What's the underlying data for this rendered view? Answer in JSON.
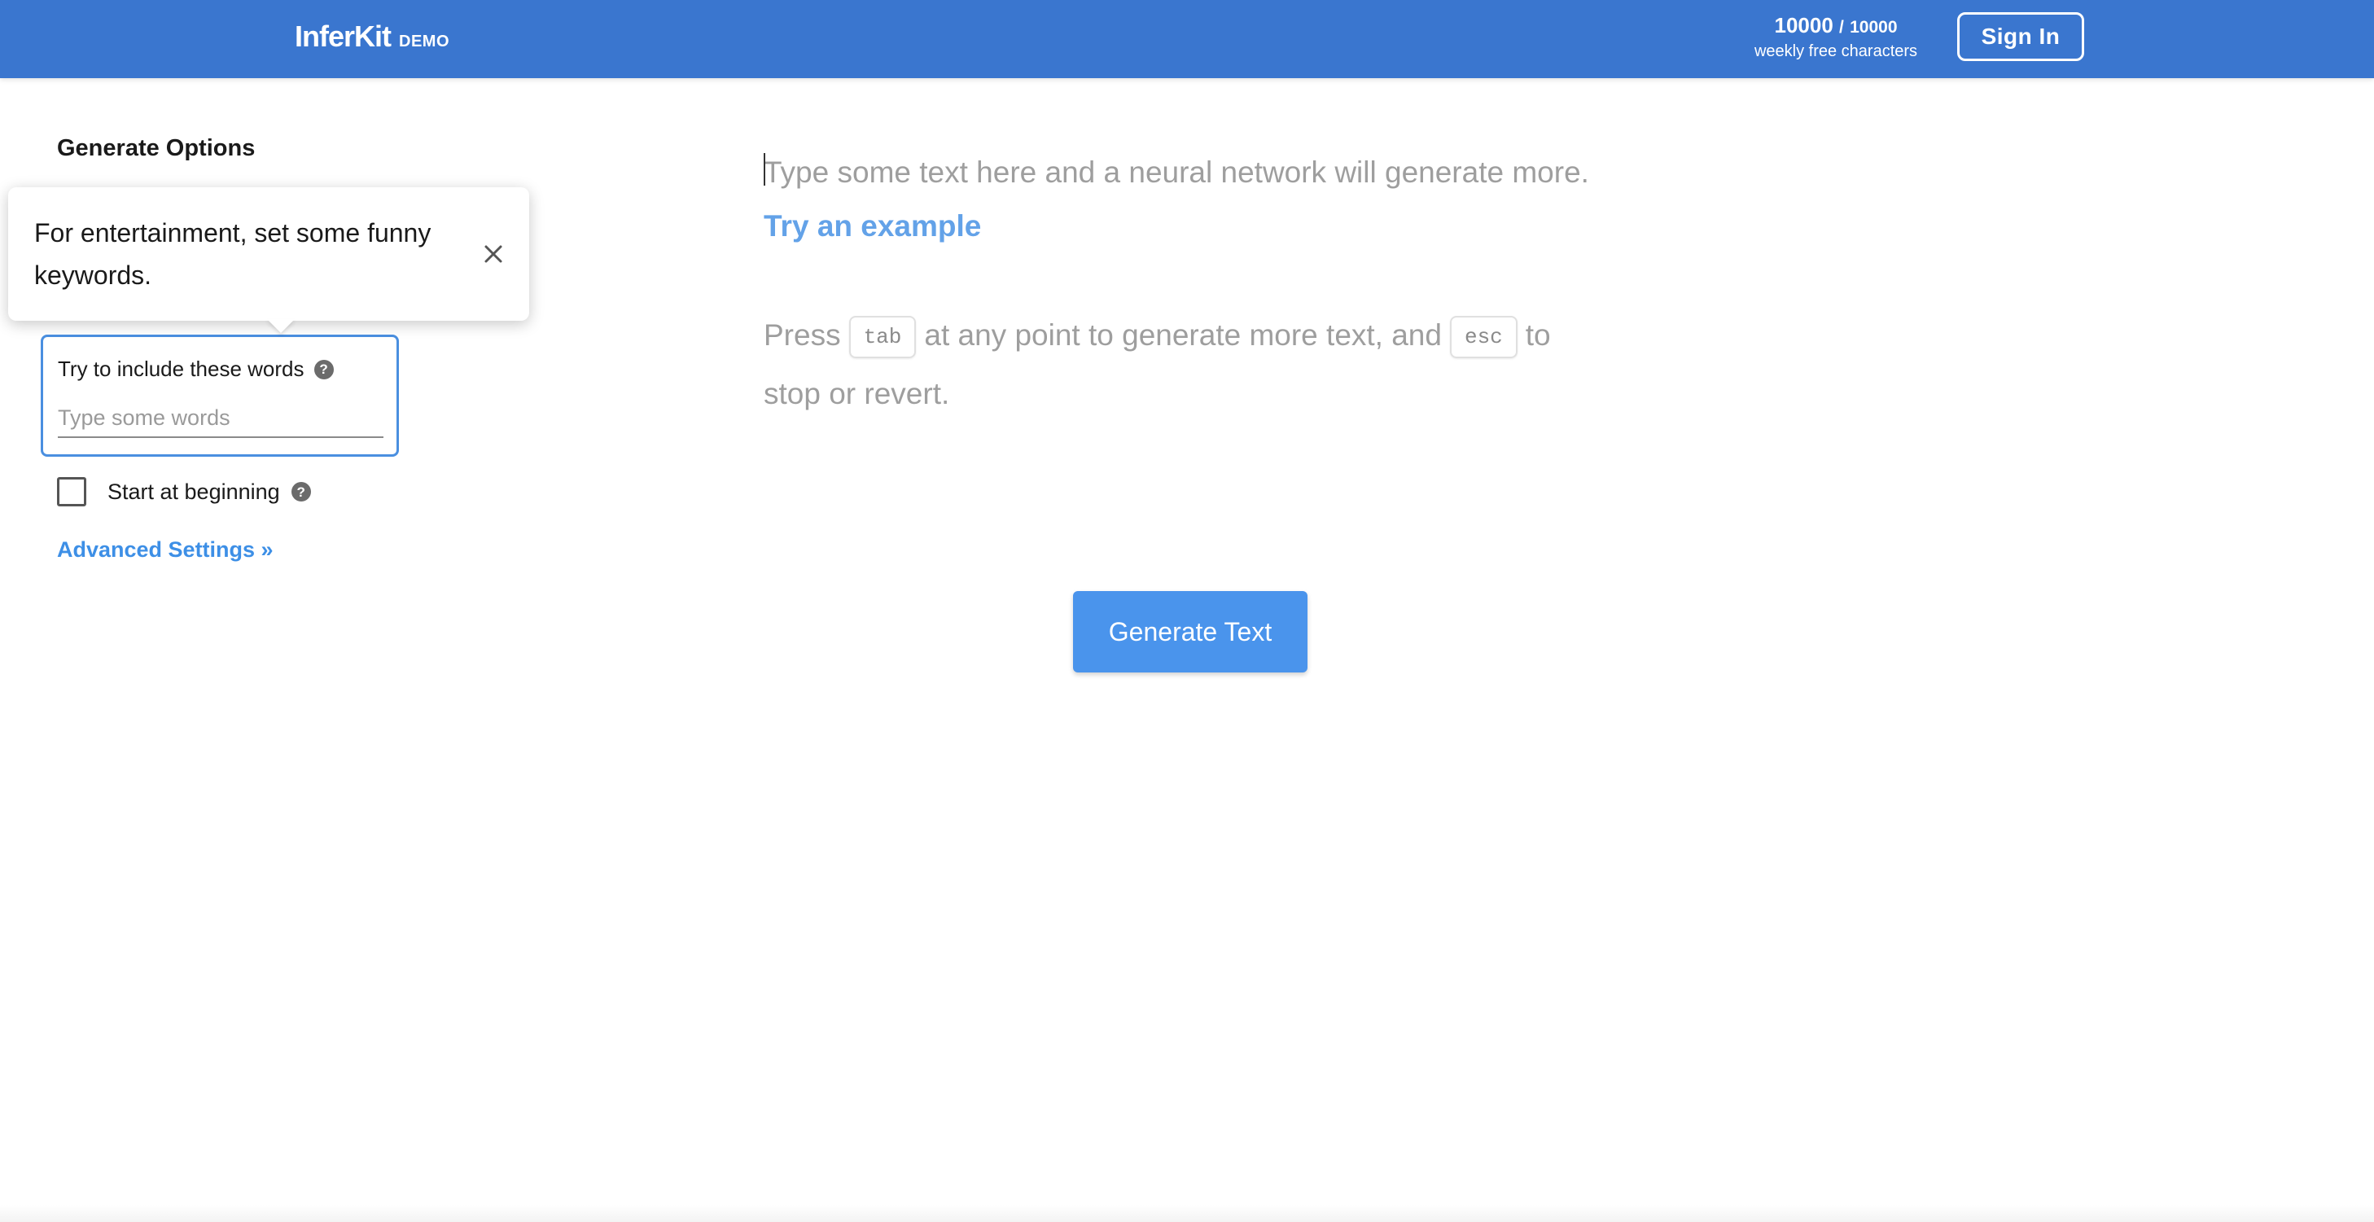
{
  "header": {
    "brand_name": "InferKit",
    "brand_tag": "DEMO",
    "quota_used": "10000",
    "quota_sep": "/",
    "quota_total": "10000",
    "quota_caption": "weekly free characters",
    "signin_label": "Sign In"
  },
  "sidebar": {
    "title": "Generate Options",
    "keywords": {
      "label": "Try to include these words",
      "placeholder": "Type some words",
      "value": ""
    },
    "start_at_beginning": {
      "label": "Start at beginning",
      "checked": false
    },
    "advanced_link": "Advanced Settings »"
  },
  "tooltip": {
    "text": "For entertainment, set some funny keywords."
  },
  "editor": {
    "placeholder": "Type some text here and a neural network will generate more.",
    "example_link": "Try an example",
    "instr_press": "Press",
    "key_tab": "tab",
    "instr_middle": "at any point to generate more text, and",
    "key_esc": "esc",
    "instr_end": "to stop or revert."
  },
  "actions": {
    "generate_label": "Generate Text"
  },
  "icons": {
    "help": "help-icon",
    "close": "close-icon"
  },
  "colors": {
    "header_bg": "#3a76cf",
    "accent": "#4a94ec",
    "link": "#3d8fe6",
    "focus_border": "#4a8fe0"
  }
}
